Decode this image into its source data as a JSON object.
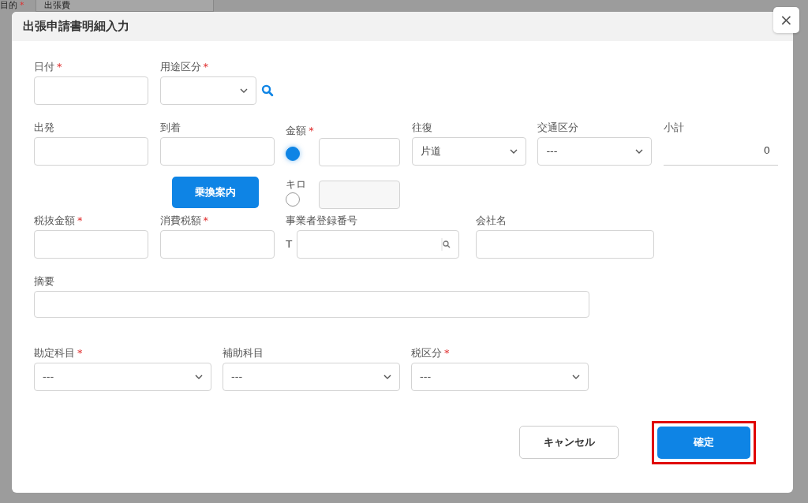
{
  "background": {
    "label": "目的",
    "required": "*",
    "select_value": "出張費"
  },
  "dialog": {
    "title": "出張申請書明細入力",
    "close": "×"
  },
  "row1": [
    {
      "kind": "input",
      "label": "日付",
      "required": "*"
    },
    {
      "kind": "select",
      "label": "用途区分",
      "required": "*",
      "search": true
    }
  ],
  "row2": [
    {
      "kind": "input",
      "label": "出発"
    },
    {
      "kind": "input",
      "label": "到着",
      "button": "乗換案内"
    },
    {
      "kind": "radio-group",
      "options": [
        {
          "label": "金額",
          "required": "*",
          "selected": true
        },
        {
          "label": "キロ",
          "selected": false
        }
      ]
    },
    {
      "kind": "select",
      "label": "往復",
      "value": "片道"
    },
    {
      "kind": "select",
      "label": "交通区分",
      "value": "---"
    },
    {
      "kind": "readout",
      "label": "小計",
      "value": "0"
    }
  ],
  "row3": [
    {
      "kind": "input",
      "label": "税抜金額",
      "required": "*"
    },
    {
      "kind": "input",
      "label": "消費税額",
      "required": "*"
    },
    {
      "kind": "search-input",
      "label": "事業者登録番号",
      "prefix": "T"
    },
    {
      "kind": "input",
      "label": "会社名"
    }
  ],
  "memo": {
    "label": "摘要"
  },
  "row4": [
    {
      "kind": "select",
      "label": "勘定科目",
      "required": "*",
      "value": "---"
    },
    {
      "kind": "select",
      "label": "補助科目",
      "value": "---"
    },
    {
      "kind": "select",
      "label": "税区分",
      "required": "*",
      "value": "---"
    }
  ],
  "buttons": [
    {
      "label": "キャンセル",
      "kind": "secondary",
      "highlighted": false
    },
    {
      "label": "確定",
      "kind": "primary",
      "highlighted": true
    }
  ]
}
